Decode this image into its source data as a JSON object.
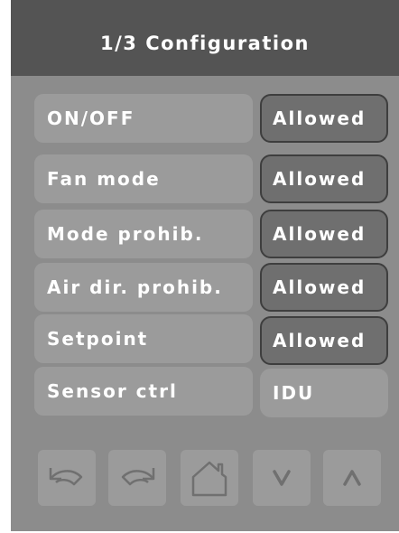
{
  "header": {
    "title": "1/3 Configuration"
  },
  "settings": [
    {
      "label": "ON/OFF",
      "value": "Allowed"
    },
    {
      "label": "Fan mode",
      "value": "Allowed"
    },
    {
      "label": "Mode prohib.",
      "value": "Allowed"
    },
    {
      "label": "Air dir. prohib.",
      "value": "Allowed"
    },
    {
      "label": "Setpoint",
      "value": "Allowed"
    },
    {
      "label": "Sensor ctrl",
      "value": "IDU"
    }
  ],
  "nav": [
    {
      "icon": "undo-icon"
    },
    {
      "icon": "redo-icon"
    },
    {
      "icon": "home-icon"
    },
    {
      "icon": "chevron-down-icon"
    },
    {
      "icon": "chevron-up-icon"
    }
  ],
  "colors": {
    "header_bg": "#545454",
    "panel_bg": "#8c8c8c",
    "button_bg": "#9b9b9b",
    "value_bg": "#6f6f6f",
    "text": "#ffffff"
  }
}
